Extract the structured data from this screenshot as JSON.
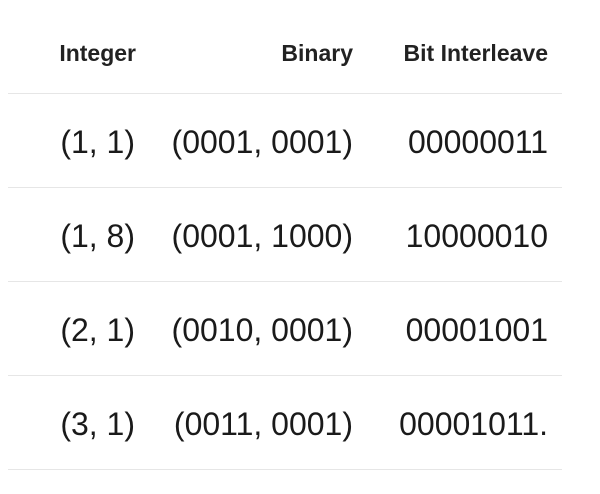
{
  "table": {
    "headers": {
      "integer": "Integer",
      "binary": "Binary",
      "bits": "Bit Interleave"
    },
    "rows": [
      {
        "integer": "(1, 1)",
        "binary": "(0001, 0001)",
        "bits": "00000011"
      },
      {
        "integer": "(1, 8)",
        "binary": "(0001, 1000)",
        "bits": "10000010"
      },
      {
        "integer": "(2, 1)",
        "binary": "(0010, 0001)",
        "bits": "00001001"
      },
      {
        "integer": "(3, 1)",
        "binary": "(0011, 0001)",
        "bits": "00001011."
      }
    ]
  }
}
